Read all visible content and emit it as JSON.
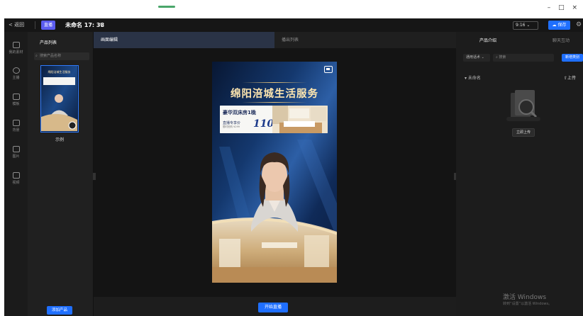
{
  "window": {
    "controls": "– □ ×"
  },
  "titlebar": {
    "back_label": "< 返回",
    "badge_label": "直播",
    "project_title": "未命名 17: 38",
    "edit_icon": "pencil-icon",
    "aspect_ratio": "9:16",
    "save_label": "保存"
  },
  "sidenav": {
    "items": [
      {
        "label": "我的素材",
        "icon": "folder-icon"
      },
      {
        "label": "主播",
        "icon": "person-icon"
      },
      {
        "label": "模板",
        "icon": "template-icon"
      },
      {
        "label": "背景",
        "icon": "image-icon"
      },
      {
        "label": "图片",
        "icon": "picture-icon"
      },
      {
        "label": "视频",
        "icon": "video-icon"
      }
    ]
  },
  "product_list": {
    "header": "产品列表",
    "search_placeholder": "搜索产品名称",
    "items": [
      {
        "name": "示例",
        "thumb_title": "绵阳涪城生活服务"
      }
    ],
    "add_button": "添加产品"
  },
  "canvas": {
    "tabs": [
      {
        "label": "画面编辑",
        "active": true
      },
      {
        "label": "播出列表",
        "active": false
      }
    ],
    "start_live_label": "开始直播",
    "preview": {
      "title": "绵阳涪城生活服务",
      "banner_line1": "豪华双床房1晚",
      "banner_line2": "直播专享价",
      "banner_line3": "限时抢购 ¥299",
      "banner_price": "110"
    }
  },
  "right_panel": {
    "tabs": [
      {
        "label": "产品介绍",
        "active": true
      },
      {
        "label": "聊天互动",
        "active": false
      }
    ],
    "select_label": "通用话术",
    "search_placeholder": "搜索",
    "new_button": "新增类别",
    "tree_item": "未命名",
    "upload_link": "上传",
    "upload_button": "立即上传"
  },
  "watermark": {
    "line1": "激活 Windows",
    "line2": "转到“设置”以激活 Windows。"
  },
  "colors": {
    "accent": "#1f6fff",
    "badge": "#5b5cf0",
    "panel_bg": "#1c1c1c",
    "title_gold": "#ffe7b0"
  }
}
